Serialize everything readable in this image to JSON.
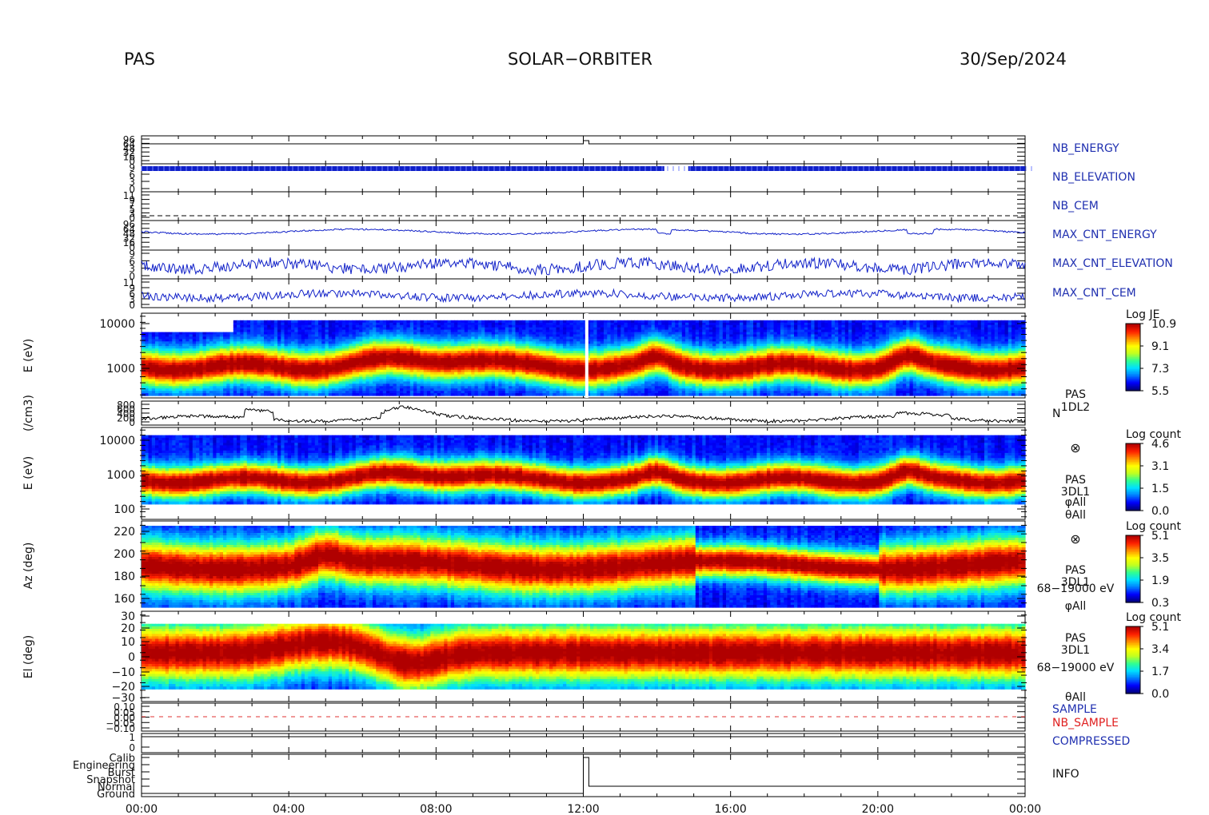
{
  "header": {
    "instrument": "PAS",
    "mission": "SOLAR−ORBITER",
    "date": "30/Sep/2024"
  },
  "colors": {
    "trace_blue": "#1020c8",
    "trace_black": "#000000",
    "sample_red": "#e03030",
    "label_blue": "#2030b0",
    "label_red": "#e02020",
    "spectrum_scale": [
      "#000080",
      "#0000ff",
      "#0080ff",
      "#00e0ff",
      "#30ff90",
      "#c0ff20",
      "#ffff00",
      "#ff9000",
      "#ff2000",
      "#b00000"
    ]
  },
  "chart_data": [
    {
      "type": "line",
      "id": "nb_energy",
      "label": "NB_ENERGY",
      "ticks": [
        "96",
        "64",
        "48",
        "32",
        "16",
        "0"
      ],
      "x": [
        "00:00",
        "12:00",
        "12:10",
        "24:00"
      ],
      "values": [
        0,
        0,
        5,
        5
      ]
    },
    {
      "type": "line",
      "id": "nb_elevation",
      "label": "NB_ELEVATION",
      "ticks": [
        "9",
        "6",
        "3",
        "0"
      ],
      "note": "dense periodic trace with gap near 14:10–14:40"
    },
    {
      "type": "line",
      "id": "nb_cem",
      "label": "NB_CEM",
      "ticks": [
        "11",
        "9",
        "7",
        "5",
        "3",
        "0"
      ],
      "style": "dashed-constant"
    },
    {
      "type": "line",
      "id": "max_cnt_energy",
      "label": "MAX_CNT_ENERGY",
      "ticks": [
        "96",
        "64",
        "48",
        "32",
        "16",
        "0"
      ]
    },
    {
      "type": "line",
      "id": "max_cnt_elevation",
      "label": "MAX_CNT_ELEVATION",
      "ticks": [
        "9",
        "6",
        "3",
        "0"
      ]
    },
    {
      "type": "line",
      "id": "max_cnt_cem",
      "label": "MAX_CNT_CEM",
      "ticks": [
        "11",
        "9",
        "6",
        "3",
        "0"
      ]
    },
    {
      "type": "heatmap",
      "id": "pas_1dl2_je",
      "ylabel": "E (eV)",
      "yscale": "log",
      "ylim": [
        200,
        20000
      ],
      "ytick_labels": [
        "10000",
        "1000"
      ],
      "right_label": [
        "PAS",
        "1DL2"
      ],
      "colorbar": {
        "title": "Log JE",
        "ticks": [
          "10.9",
          "9.1",
          "7.3",
          "5.5"
        ],
        "range": [
          5.5,
          10.9
        ]
      }
    },
    {
      "type": "line",
      "id": "density",
      "ylabel": "(/cm3)",
      "ytick_labels": [
        "800",
        "600",
        "400",
        "200",
        "0"
      ],
      "right_label": "N"
    },
    {
      "type": "heatmap",
      "id": "pas_3dl1_energy",
      "ylabel": "E (eV)",
      "yscale": "log",
      "ylim": [
        60,
        20000
      ],
      "ytick_labels": [
        "10000",
        "1000",
        "100"
      ],
      "right_label": [
        "⊗",
        "PAS",
        "3DL1",
        "φAll",
        "θAll"
      ],
      "colorbar": {
        "title": "Log count",
        "ticks": [
          "4.6",
          "3.1",
          "1.5",
          "0.0"
        ],
        "range": [
          0.0,
          4.6
        ]
      }
    },
    {
      "type": "heatmap",
      "id": "pas_3dl1_azimuth",
      "ylabel": "Az (deg)",
      "ylim": [
        155,
        225
      ],
      "ytick_labels": [
        "220",
        "200",
        "180",
        "160"
      ],
      "right_label": [
        "⊗",
        "PAS",
        "3DL1",
        "68−19000 eV",
        "φAll"
      ],
      "colorbar": {
        "title": "Log count",
        "ticks": [
          "5.1",
          "3.5",
          "1.9",
          "0.3"
        ],
        "range": [
          0.3,
          5.1
        ]
      }
    },
    {
      "type": "heatmap",
      "id": "pas_3dl1_elevation",
      "ylabel": "El (deg)",
      "ylim": [
        -30,
        30
      ],
      "ytick_labels": [
        "30",
        "20",
        "10",
        "0",
        "−10",
        "−20",
        "−30"
      ],
      "right_label": [
        "PAS",
        "3DL1",
        "68−19000 eV",
        "θAll"
      ],
      "colorbar": {
        "title": "Log count",
        "ticks": [
          "5.1",
          "3.4",
          "1.7",
          "0.0"
        ],
        "range": [
          0.0,
          5.1
        ]
      }
    },
    {
      "type": "line",
      "id": "sample",
      "labels": [
        "SAMPLE",
        "NB_SAMPLE"
      ],
      "ytick_labels": [
        "0.10",
        "0.05",
        "0.00",
        "−0.05",
        "−0.10"
      ],
      "values": [
        0,
        0
      ]
    },
    {
      "type": "line",
      "id": "compressed",
      "label": "COMPRESSED",
      "ytick_labels": [
        "1",
        "0"
      ],
      "values": [
        1,
        1
      ]
    },
    {
      "type": "line",
      "id": "info",
      "label": "INFO",
      "ytick_labels": [
        "Calib",
        "Engineering",
        "Burst",
        "Snapshot",
        "Normal",
        "Ground"
      ],
      "x": [
        "00:00",
        "12:00",
        "12:10",
        "24:00"
      ],
      "values": [
        "Ground",
        "Ground",
        "Calib",
        "Ground"
      ]
    }
  ],
  "time_axis": {
    "labels": [
      "00:00",
      "04:00",
      "08:00",
      "12:00",
      "16:00",
      "20:00",
      "00:00"
    ]
  }
}
